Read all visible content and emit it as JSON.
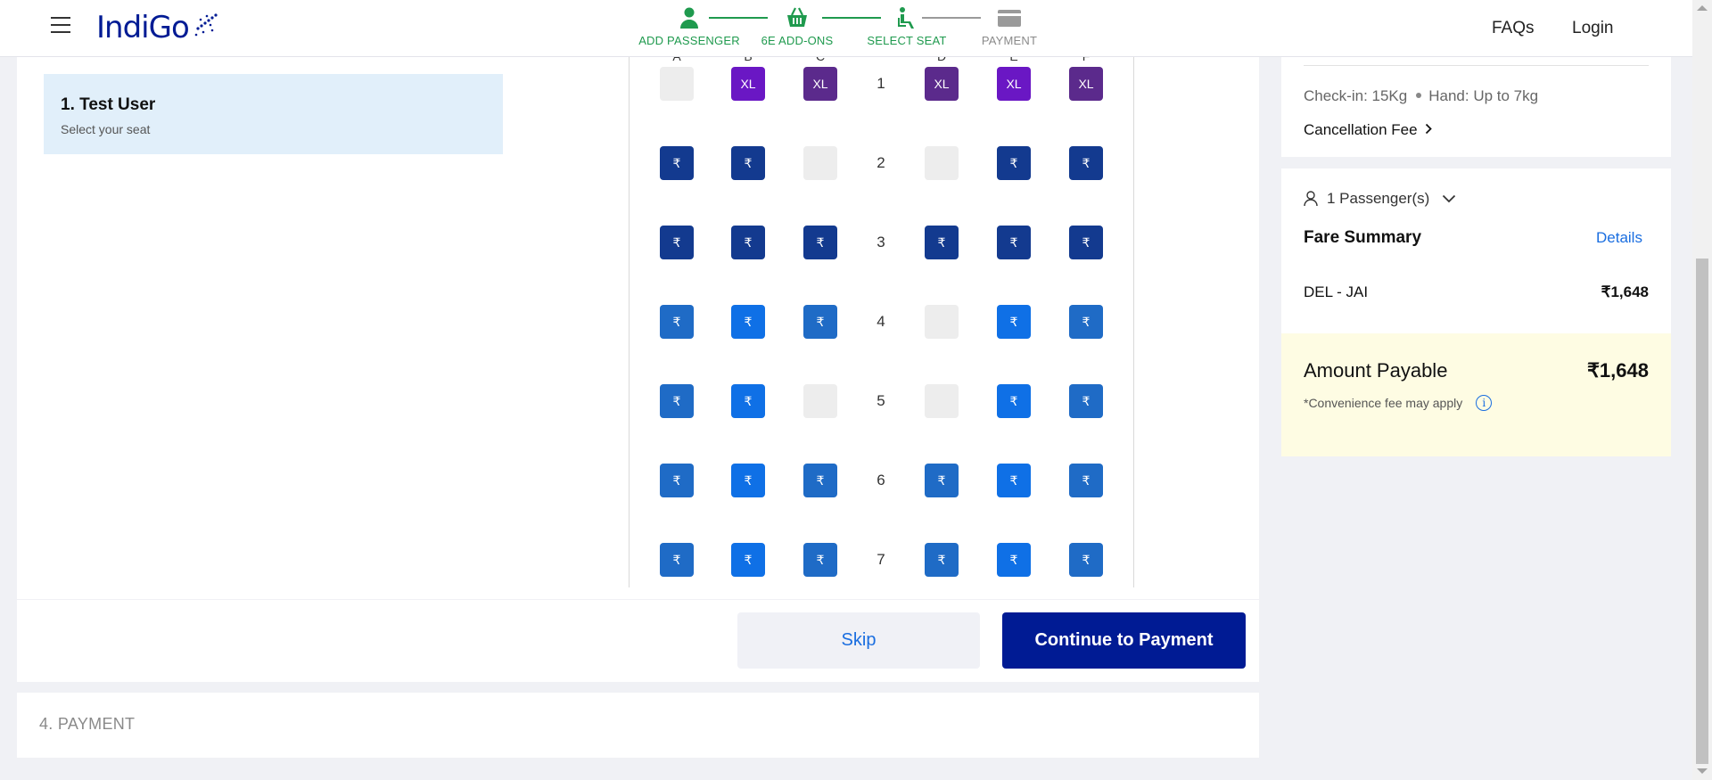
{
  "header": {
    "logo_text": "IndiGo",
    "faqs": "FAQs",
    "login": "Login",
    "steps": [
      {
        "label": "ADD PASSENGER",
        "icon": "person-icon",
        "status": "done"
      },
      {
        "label": "6E ADD-ONS",
        "icon": "basket-icon",
        "status": "done"
      },
      {
        "label": "SELECT SEAT",
        "icon": "seat-icon",
        "status": "current"
      },
      {
        "label": "PAYMENT",
        "icon": "card-icon",
        "status": "todo"
      }
    ]
  },
  "passenger": {
    "name": "1. Test User",
    "hint": "Select your seat"
  },
  "seat_map": {
    "columns": [
      "A",
      "B",
      "C",
      "D",
      "E",
      "F"
    ],
    "rows": [
      {
        "number": "1",
        "seats": [
          {
            "t": "blocked",
            "label": ""
          },
          {
            "t": "xl-a",
            "label": "XL"
          },
          {
            "t": "xl-b",
            "label": "XL"
          },
          {
            "t": "xl-b",
            "label": "XL"
          },
          {
            "t": "xl-a",
            "label": "XL"
          },
          {
            "t": "xl-b",
            "label": "XL"
          }
        ]
      },
      {
        "number": "2",
        "seats": [
          {
            "t": "dark",
            "label": "₹"
          },
          {
            "t": "dark",
            "label": "₹"
          },
          {
            "t": "blocked",
            "label": ""
          },
          {
            "t": "blocked",
            "label": ""
          },
          {
            "t": "dark",
            "label": "₹"
          },
          {
            "t": "dark",
            "label": "₹"
          }
        ]
      },
      {
        "number": "3",
        "seats": [
          {
            "t": "dark",
            "label": "₹"
          },
          {
            "t": "dark",
            "label": "₹"
          },
          {
            "t": "dark",
            "label": "₹"
          },
          {
            "t": "dark",
            "label": "₹"
          },
          {
            "t": "dark",
            "label": "₹"
          },
          {
            "t": "dark",
            "label": "₹"
          }
        ]
      },
      {
        "number": "4",
        "seats": [
          {
            "t": "mid",
            "label": "₹"
          },
          {
            "t": "bright",
            "label": "₹"
          },
          {
            "t": "mid",
            "label": "₹"
          },
          {
            "t": "blocked",
            "label": ""
          },
          {
            "t": "bright",
            "label": "₹"
          },
          {
            "t": "mid",
            "label": "₹"
          }
        ]
      },
      {
        "number": "5",
        "seats": [
          {
            "t": "mid",
            "label": "₹"
          },
          {
            "t": "bright",
            "label": "₹"
          },
          {
            "t": "blocked",
            "label": ""
          },
          {
            "t": "blocked",
            "label": ""
          },
          {
            "t": "bright",
            "label": "₹"
          },
          {
            "t": "mid",
            "label": "₹"
          }
        ]
      },
      {
        "number": "6",
        "seats": [
          {
            "t": "mid",
            "label": "₹"
          },
          {
            "t": "bright",
            "label": "₹"
          },
          {
            "t": "mid",
            "label": "₹"
          },
          {
            "t": "mid",
            "label": "₹"
          },
          {
            "t": "bright",
            "label": "₹"
          },
          {
            "t": "mid",
            "label": "₹"
          }
        ]
      },
      {
        "number": "7",
        "seats": [
          {
            "t": "mid",
            "label": "₹"
          },
          {
            "t": "bright",
            "label": "₹"
          },
          {
            "t": "mid",
            "label": "₹"
          },
          {
            "t": "mid",
            "label": "₹"
          },
          {
            "t": "bright",
            "label": "₹"
          },
          {
            "t": "mid",
            "label": "₹"
          }
        ]
      }
    ]
  },
  "actions": {
    "skip": "Skip",
    "continue": "Continue to Payment"
  },
  "payment_section": {
    "title": "4. PAYMENT"
  },
  "sidebar": {
    "baggage_checkin": "Check-in: 15Kg",
    "baggage_hand": "Hand: Up to 7kg",
    "cancellation_fee": "Cancellation Fee",
    "passenger_count": "1 Passenger(s)",
    "fare_summary_title": "Fare Summary",
    "details_link": "Details",
    "route": "DEL - JAI",
    "route_amount": "₹1,648",
    "amount_payable_label": "Amount Payable",
    "amount_payable": "₹1,648",
    "convenience_note": "*Convenience fee may apply",
    "info_glyph": "i"
  },
  "colors": {
    "brand": "#001b94",
    "step_done": "#1f9a4e",
    "link": "#1a6ee0",
    "seat_xl_a": "#6a17c4",
    "seat_xl_b": "#5b2a8c",
    "seat_dark": "#133a8f",
    "seat_mid": "#1f6bc6",
    "seat_bright": "#0f70e6",
    "payable_bg": "#fefce3"
  }
}
